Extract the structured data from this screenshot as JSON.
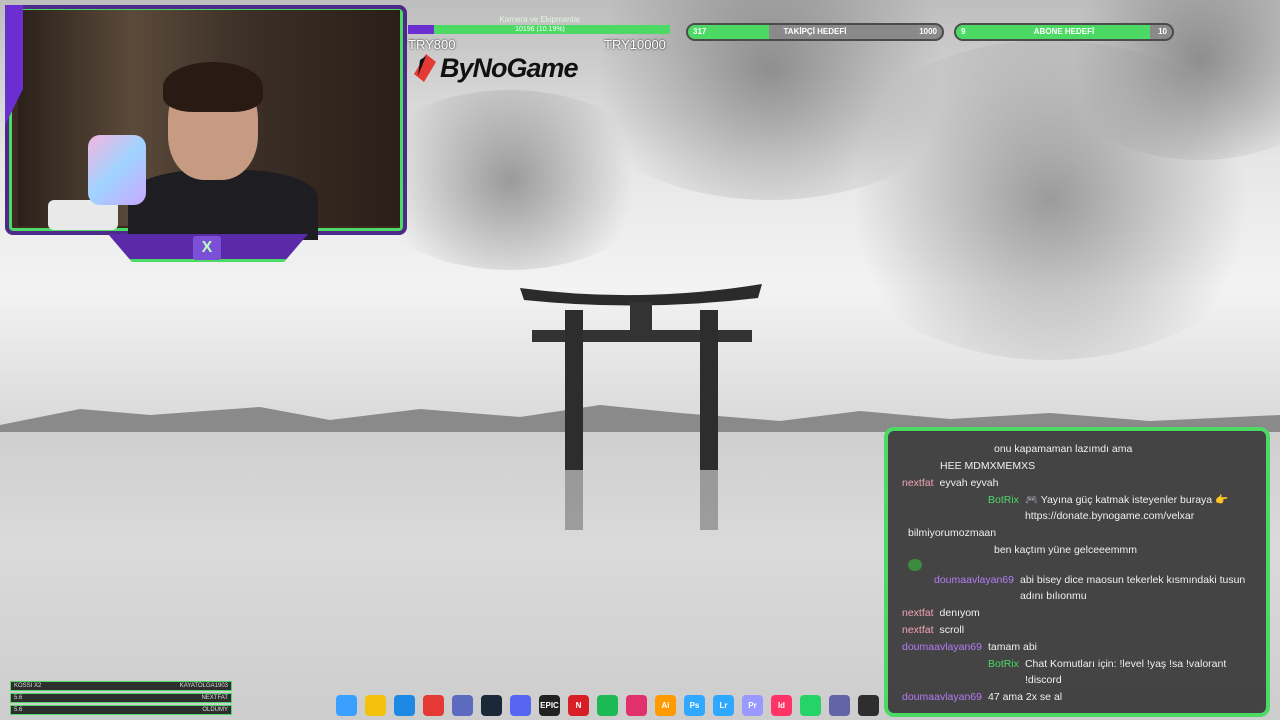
{
  "donation_goal": {
    "title": "Kamera ve Ekipmanlar",
    "progress_text": "10196 (10.19%)",
    "progress_fraction": 0.1019,
    "min_label": "TRY800",
    "max_label": "TRY10000"
  },
  "brand": {
    "name": "ByNoGame"
  },
  "follower_goal": {
    "current": "317",
    "label": "TAKİPÇİ HEDEFİ",
    "target": "1000",
    "progress_fraction": 0.317
  },
  "sub_goal": {
    "current": "9",
    "label": "ABONE HEDEFİ",
    "target": "10",
    "progress_fraction": 0.9
  },
  "chat": {
    "messages": [
      {
        "user": "",
        "user_color": "#3b82f6",
        "text": "onu kapamaman lazımdı ama",
        "layout": "indent"
      },
      {
        "user": "",
        "user_color": "#3b82f6",
        "text": "HEE MDMXMEMXS",
        "layout": "indent2"
      },
      {
        "user": "nextfat",
        "user_color": "#f2a3b5",
        "text": "eyvah eyvah",
        "layout": "normal"
      },
      {
        "user": "BotRix",
        "user_color": "#4cd964",
        "text": "🎮 Yayına güç katmak isteyenler buraya 👉 https://donate.bynogame.com/velxar",
        "layout": "indent"
      },
      {
        "user": "",
        "user_color": "#3b82f6",
        "text": "bilmiyorumozmaan",
        "layout": "normal"
      },
      {
        "user": "",
        "user_color": "#3b82f6",
        "text": "ben kaçtım yüne gelceeemmm",
        "layout": "indent"
      },
      {
        "user": "",
        "user_color": "#3b82f6",
        "text": "",
        "layout": "normal",
        "emote": "green-emote"
      },
      {
        "user": "doumaavlayan69",
        "user_color": "#b57cf5",
        "text": "abi bisey dice maosun tekerlek kısmındaki tusun adını bılıonmu",
        "layout": "indent2"
      },
      {
        "user": "nextfat",
        "user_color": "#f2a3b5",
        "text": "denıyom",
        "layout": "normal"
      },
      {
        "user": "nextfat",
        "user_color": "#f2a3b5",
        "text": "scroll",
        "layout": "normal"
      },
      {
        "user": "doumaavlayan69",
        "user_color": "#b57cf5",
        "text": "tamam abi",
        "layout": "normal"
      },
      {
        "user": "BotRix",
        "user_color": "#4cd964",
        "text": "Chat Komutları için: !level !yaş !sa !valorant !discord",
        "layout": "indent"
      },
      {
        "user": "doumaavlayan69",
        "user_color": "#b57cf5",
        "text": "47 ama 2x se al",
        "layout": "normal"
      }
    ]
  },
  "hud": {
    "rows": [
      {
        "left": "KOSSI X2",
        "right": "KAYATOLGA1903"
      },
      {
        "left": "5.6",
        "right": "NEXTFAT"
      },
      {
        "left": "5.6",
        "right": "OLDUMY"
      }
    ]
  },
  "taskbar": {
    "icons": [
      {
        "name": "windows-start-icon",
        "glyph": "",
        "color": "#3aa0ff"
      },
      {
        "name": "file-explorer-icon",
        "glyph": "",
        "color": "#f4c20d"
      },
      {
        "name": "edge-icon",
        "glyph": "",
        "color": "#1e88e5"
      },
      {
        "name": "chrome-icon",
        "glyph": "",
        "color": "#e53935"
      },
      {
        "name": "store-icon",
        "glyph": "",
        "color": "#5c6bc0"
      },
      {
        "name": "steam-icon",
        "glyph": "",
        "color": "#1b2838"
      },
      {
        "name": "discord-icon",
        "glyph": "",
        "color": "#5865f2"
      },
      {
        "name": "epic-games-icon",
        "glyph": "EPIC",
        "color": "#222222"
      },
      {
        "name": "netflix-icon",
        "glyph": "N",
        "color": "#d81f26"
      },
      {
        "name": "spotify-icon",
        "glyph": "",
        "color": "#1db954"
      },
      {
        "name": "instagram-icon",
        "glyph": "",
        "color": "#e1306c"
      },
      {
        "name": "illustrator-icon",
        "glyph": "Ai",
        "color": "#ff9a00"
      },
      {
        "name": "photoshop-icon",
        "glyph": "Ps",
        "color": "#31a8ff"
      },
      {
        "name": "lightroom-icon",
        "glyph": "Lr",
        "color": "#31a8ff"
      },
      {
        "name": "premiere-icon",
        "glyph": "Pr",
        "color": "#9999ff"
      },
      {
        "name": "indesign-icon",
        "glyph": "Id",
        "color": "#ff3366"
      },
      {
        "name": "whatsapp-icon",
        "glyph": "",
        "color": "#25d366"
      },
      {
        "name": "teams-icon",
        "glyph": "",
        "color": "#6264a7"
      },
      {
        "name": "obs-icon",
        "glyph": "",
        "color": "#2e2e2e"
      }
    ]
  },
  "colors": {
    "accent_green": "#4cd964",
    "accent_purple": "#6a2ed1"
  }
}
